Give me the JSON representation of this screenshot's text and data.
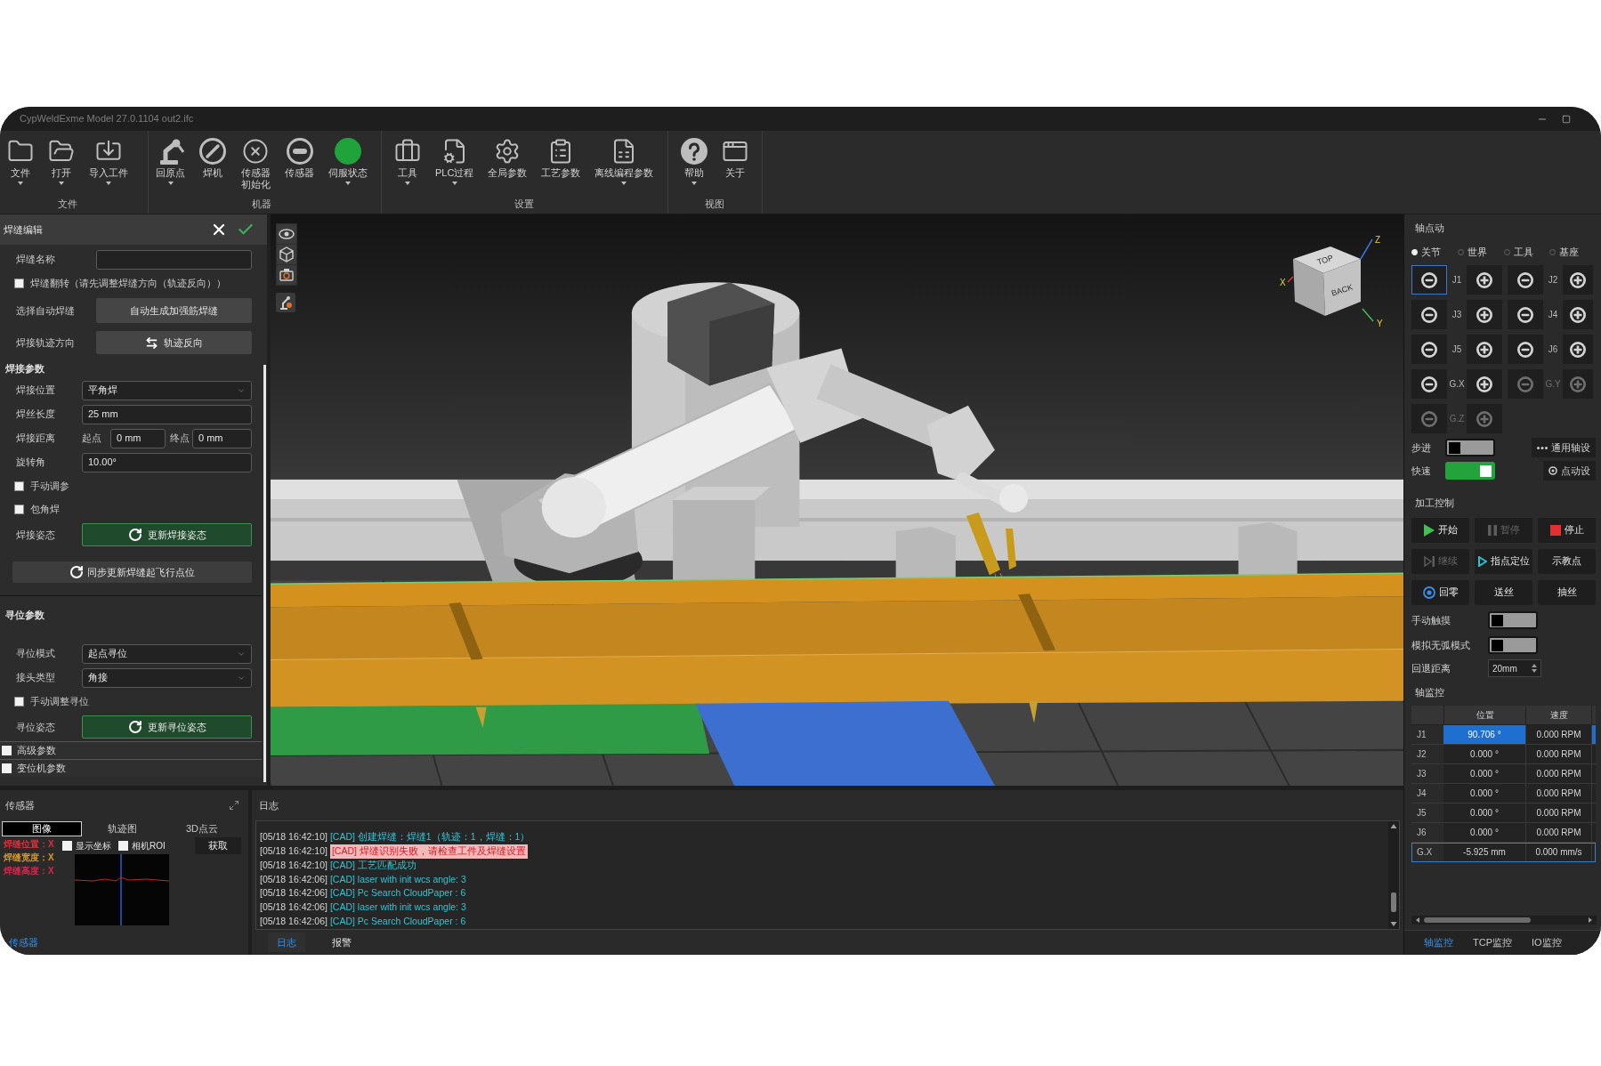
{
  "window": {
    "title": "CypWeldExme Model 27.0.1104 out2.ifc"
  },
  "ribbon": {
    "groups": [
      {
        "label": "文件",
        "items": [
          {
            "kind": "button",
            "label": "文件",
            "dropdown": true
          },
          {
            "kind": "button",
            "label": "打开",
            "dropdown": true
          },
          {
            "kind": "button",
            "label": "导入工件",
            "dropdown": true
          }
        ]
      },
      {
        "label": "机器",
        "items": [
          {
            "kind": "button",
            "label": "回原点",
            "dropdown": true
          },
          {
            "kind": "button",
            "label": "焊机",
            "dropdown": false
          },
          {
            "kind": "button",
            "label": "传感器初始化",
            "dropdown": false
          },
          {
            "kind": "button",
            "label": "传感器",
            "dropdown": false
          },
          {
            "kind": "status",
            "label": "伺服状态",
            "dropdown": true,
            "color": "#1fa33a"
          }
        ]
      },
      {
        "label": "设置",
        "items": [
          {
            "kind": "button",
            "label": "工具",
            "dropdown": true
          },
          {
            "kind": "button",
            "label": "PLC过程",
            "dropdown": true
          },
          {
            "kind": "button",
            "label": "全局参数",
            "dropdown": false
          },
          {
            "kind": "button",
            "label": "工艺参数",
            "dropdown": false
          },
          {
            "kind": "button",
            "label": "离线编程参数",
            "dropdown": true
          }
        ]
      },
      {
        "label": "视图",
        "items": [
          {
            "kind": "button",
            "label": "帮助",
            "dropdown": true
          },
          {
            "kind": "button",
            "label": "关于",
            "dropdown": false
          }
        ]
      }
    ]
  },
  "weld_editor": {
    "title": "焊缝编辑",
    "rows": [
      {
        "kind": "input",
        "label": "焊缝名称"
      },
      {
        "kind": "checkbox",
        "label": "焊缝翻转（请先调整焊缝方向（轨迹反向））",
        "checked": false
      },
      {
        "kind": "button",
        "label": "选择自动焊缝",
        "button": "自动生成加强筋焊缝"
      },
      {
        "kind": "swap_button",
        "label": "焊接轨迹方向",
        "button": "轨迹反向"
      },
      {
        "kind": "heading",
        "label": "焊接参数",
        "divider": false
      },
      {
        "kind": "select",
        "label": "焊接位置",
        "value": "平角焊"
      },
      {
        "kind": "input",
        "label": "焊丝长度",
        "value": "25 mm"
      },
      {
        "kind": "range",
        "label": "焊接距离",
        "start_label": "起点",
        "start": "0 mm",
        "end_label": "终点",
        "end": "0 mm"
      },
      {
        "kind": "input",
        "label": "旋转角",
        "value": "10.00°"
      },
      {
        "kind": "checkbox",
        "label": "手动调参",
        "checked": false
      },
      {
        "kind": "checkbox",
        "label": "包角焊",
        "checked": false
      },
      {
        "kind": "update_button",
        "label": "焊接姿态",
        "button": "更新焊接姿态"
      },
      {
        "kind": "sync_button",
        "button": "同步更新焊缝起飞行点位"
      },
      {
        "kind": "heading",
        "label": "寻位参数",
        "divider": true
      },
      {
        "kind": "select",
        "label": "寻位模式",
        "value": "起点寻位"
      },
      {
        "kind": "select",
        "label": "接头类型",
        "value": "角接"
      },
      {
        "kind": "checkbox",
        "label": "手动调整寻位",
        "checked": false
      },
      {
        "kind": "update_button",
        "label": "寻位姿态",
        "button": "更新寻位姿态"
      },
      {
        "kind": "section",
        "label": "高级参数",
        "expanded": false
      },
      {
        "kind": "section",
        "label": "变位机参数",
        "expanded": false
      }
    ]
  },
  "viewport": {
    "view_cube": {
      "faces": [
        "TOP",
        "BACK"
      ],
      "axes": [
        "Z",
        "X",
        "Y"
      ]
    }
  },
  "jog": {
    "title": "轴点动",
    "frames": [
      {
        "label": "关节",
        "selected": true
      },
      {
        "label": "世界",
        "selected": false
      },
      {
        "label": "工具",
        "selected": false
      },
      {
        "label": "基座",
        "selected": false
      }
    ],
    "axes": [
      {
        "label": "J1",
        "disabled": false,
        "focused": true
      },
      {
        "label": "J2",
        "disabled": false,
        "focused": false
      },
      {
        "label": "J3",
        "disabled": false,
        "focused": false
      },
      {
        "label": "J4",
        "disabled": false,
        "focused": false
      },
      {
        "label": "J5",
        "disabled": false,
        "focused": false
      },
      {
        "label": "J6",
        "disabled": false,
        "focused": false
      },
      {
        "label": "G.X",
        "disabled": false,
        "focused": false
      },
      {
        "label": "G.Y",
        "disabled": true,
        "focused": false
      },
      {
        "label": "G.Z",
        "disabled": true,
        "focused": false
      }
    ],
    "switches": [
      {
        "label": "步进",
        "on": false
      },
      {
        "label": "快速",
        "on": true
      }
    ],
    "settings": [
      "通用轴设",
      "点动设"
    ]
  },
  "process": {
    "title": "加工控制",
    "buttons": [
      {
        "label": "开始",
        "disabled": false
      },
      {
        "label": "暂停",
        "disabled": true
      },
      {
        "label": "停止",
        "disabled": false
      },
      {
        "label": "继续",
        "disabled": true
      },
      {
        "label": "指点定位",
        "disabled": false
      },
      {
        "label": "示教点",
        "disabled": false
      },
      {
        "label": "回零",
        "disabled": false
      },
      {
        "label": "送丝",
        "disabled": false
      },
      {
        "label": "抽丝",
        "disabled": false
      }
    ],
    "switches": [
      {
        "label": "手动触摸",
        "on": false
      },
      {
        "label": "模拟无弧模式",
        "on": false
      }
    ],
    "retreat": {
      "label": "回退距离",
      "value": "20mm"
    }
  },
  "axis_monitor": {
    "title": "轴监控",
    "columns": [
      "位置",
      "速度"
    ],
    "rows": [
      {
        "axis": "J1",
        "position": "90.706 °",
        "speed": "0.000 RPM",
        "selected": true,
        "focused": false
      },
      {
        "axis": "J2",
        "position": "0.000 °",
        "speed": "0.000 RPM",
        "selected": false,
        "focused": false
      },
      {
        "axis": "J3",
        "position": "0.000 °",
        "speed": "0.000 RPM",
        "selected": false,
        "focused": false
      },
      {
        "axis": "J4",
        "position": "0.000 °",
        "speed": "0.000 RPM",
        "selected": false,
        "focused": false
      },
      {
        "axis": "J5",
        "position": "0.000 °",
        "speed": "0.000 RPM",
        "selected": false,
        "focused": false
      },
      {
        "axis": "J6",
        "position": "0.000 °",
        "speed": "0.000 RPM",
        "selected": false,
        "focused": false
      },
      {
        "axis": "G.X",
        "position": "-5.925 mm",
        "speed": "0.000 mm/s",
        "selected": false,
        "focused": true
      }
    ],
    "tabs": [
      {
        "label": "轴监控",
        "selected": true
      },
      {
        "label": "TCP监控",
        "selected": false
      },
      {
        "label": "IO监控",
        "selected": false
      }
    ]
  },
  "sensor": {
    "title": "传感器",
    "tabs": [
      {
        "label": "图像",
        "selected": true
      },
      {
        "label": "轨迹图",
        "selected": false
      },
      {
        "label": "3D点云",
        "selected": false
      }
    ],
    "legend": [
      {
        "label": "焊缝位置：X",
        "color": "#d8303c"
      },
      {
        "label": "焊缝宽度：X",
        "color": "#d99a2b"
      },
      {
        "label": "焊缝高度：X",
        "color": "#d6284e"
      }
    ],
    "options": [
      {
        "label": "显示坐标",
        "checked": false
      },
      {
        "label": "相机ROI",
        "checked": false
      }
    ],
    "fetch_button": "获取",
    "dock_tabs": [
      {
        "label": "传感器",
        "selected": true
      }
    ]
  },
  "log": {
    "title": "日志",
    "entries": [
      {
        "kind": "info",
        "time": "[05/18 16:42:10]",
        "message": "[CAD] 创建焊缝：焊缝1（轨迹：1，焊缝：1）"
      },
      {
        "kind": "error",
        "time": "[05/18 16:42:10]",
        "message": "[CAD] 焊缝识别失败，请检查工件及焊缝设置"
      },
      {
        "kind": "info",
        "time": "[05/18 16:42:10]",
        "message": "[CAD] 工艺匹配成功"
      },
      {
        "kind": "info",
        "time": "[05/18 16:42:06]",
        "message": "[CAD] laser with init wcs angle: 3"
      },
      {
        "kind": "info",
        "time": "[05/18 16:42:06]",
        "message": "[CAD] Pc Search CloudPaper : 6"
      },
      {
        "kind": "info",
        "time": "[05/18 16:42:06]",
        "message": "[CAD] laser with init wcs angle: 3"
      },
      {
        "kind": "info",
        "time": "[05/18 16:42:06]",
        "message": "[CAD] Pc Search CloudPaper : 6"
      }
    ],
    "tabs": [
      {
        "label": "日志",
        "selected": true
      },
      {
        "label": "报警",
        "selected": false
      }
    ]
  }
}
